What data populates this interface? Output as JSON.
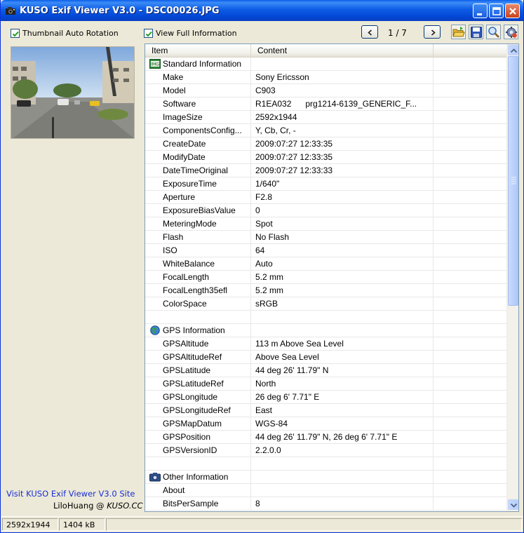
{
  "window": {
    "title": "KUSO Exif Viewer V3.0 - DSC00026.JPG"
  },
  "toolbar": {
    "thumbnail_auto_rotation": "Thumbnail Auto Rotation",
    "view_full_information": "View Full Information",
    "page_counter": "1 / 7"
  },
  "sidebar": {
    "visit_link": "Visit KUSO Exif Viewer V3.0 Site",
    "credit_name": "LiloHuang @ ",
    "credit_site": "KUSO.CC"
  },
  "list": {
    "columns": [
      "Item",
      "Content"
    ],
    "rows": [
      {
        "type": "group",
        "icon": "image-info-icon",
        "item": "Standard Information",
        "content": ""
      },
      {
        "type": "row",
        "item": "Make",
        "content": "Sony Ericsson"
      },
      {
        "type": "row",
        "item": "Model",
        "content": "C903"
      },
      {
        "type": "row",
        "item": "Software",
        "content": "R1EA032      prg1214-6139_GENERIC_F..."
      },
      {
        "type": "row",
        "item": "ImageSize",
        "content": "2592x1944"
      },
      {
        "type": "row",
        "item": "ComponentsConfig...",
        "content": "Y, Cb, Cr, -"
      },
      {
        "type": "row",
        "item": "CreateDate",
        "content": "2009:07:27 12:33:35"
      },
      {
        "type": "row",
        "item": "ModifyDate",
        "content": "2009:07:27 12:33:35"
      },
      {
        "type": "row",
        "item": "DateTimeOriginal",
        "content": "2009:07:27 12:33:33"
      },
      {
        "type": "row",
        "item": "ExposureTime",
        "content": "1/640\""
      },
      {
        "type": "row",
        "item": "Aperture",
        "content": "F2.8"
      },
      {
        "type": "row",
        "item": "ExposureBiasValue",
        "content": "0"
      },
      {
        "type": "row",
        "item": "MeteringMode",
        "content": "Spot"
      },
      {
        "type": "row",
        "item": "Flash",
        "content": "No Flash"
      },
      {
        "type": "row",
        "item": "ISO",
        "content": "64"
      },
      {
        "type": "row",
        "item": "WhiteBalance",
        "content": "Auto"
      },
      {
        "type": "row",
        "item": "FocalLength",
        "content": "5.2 mm"
      },
      {
        "type": "row",
        "item": "FocalLength35efl",
        "content": "5.2 mm"
      },
      {
        "type": "row",
        "item": "ColorSpace",
        "content": "sRGB"
      },
      {
        "type": "blank",
        "item": "",
        "content": ""
      },
      {
        "type": "group",
        "icon": "globe-icon",
        "item": "GPS Information",
        "content": ""
      },
      {
        "type": "row",
        "item": "GPSAltitude",
        "content": "113 m Above Sea Level"
      },
      {
        "type": "row",
        "item": "GPSAltitudeRef",
        "content": "Above Sea Level"
      },
      {
        "type": "row",
        "item": "GPSLatitude",
        "content": "44 deg 26' 11.79\" N"
      },
      {
        "type": "row",
        "item": "GPSLatitudeRef",
        "content": "North"
      },
      {
        "type": "row",
        "item": "GPSLongitude",
        "content": "26 deg 6' 7.71\" E"
      },
      {
        "type": "row",
        "item": "GPSLongitudeRef",
        "content": "East"
      },
      {
        "type": "row",
        "item": "GPSMapDatum",
        "content": "WGS-84"
      },
      {
        "type": "row",
        "item": "GPSPosition",
        "content": "44 deg 26' 11.79\" N, 26 deg 6' 7.71\" E"
      },
      {
        "type": "row",
        "item": "GPSVersionID",
        "content": "2.2.0.0"
      },
      {
        "type": "blank",
        "item": "",
        "content": ""
      },
      {
        "type": "group",
        "icon": "camera-icon",
        "item": "Other Information",
        "content": ""
      },
      {
        "type": "row",
        "item": "About",
        "content": ""
      },
      {
        "type": "row",
        "item": "BitsPerSample",
        "content": "8"
      }
    ]
  },
  "statusbar": {
    "dimensions": "2592x1944",
    "file_size": "1404 kB"
  },
  "colors": {
    "titlebar": "#0a5ee8",
    "link": "#1a2fd4",
    "window_bg": "#ece9d8"
  }
}
